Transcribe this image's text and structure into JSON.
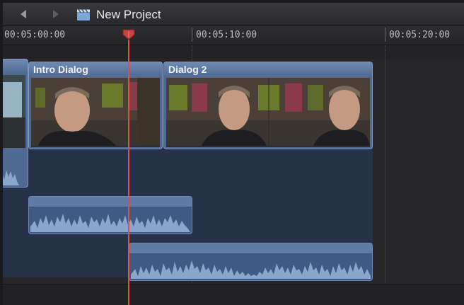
{
  "window": {
    "title": "New Project",
    "back_icon": "chevron-left-icon",
    "forward_icon": "chevron-right-icon",
    "project_icon": "clapperboard-icon"
  },
  "ruler": {
    "timecodes": [
      "00:05:00:00",
      "00:05:10:00",
      "00:05:20:00"
    ],
    "playhead_color": "#e05048"
  },
  "clips": [
    {
      "name": "Intro Dialog"
    },
    {
      "name": "Dialog 2"
    }
  ],
  "colors": {
    "clip_video": "#4e6a92",
    "clip_header": "#6f8bb3",
    "audio_clip": "#3f5b85",
    "storyline": "#253247",
    "background": "#2a2a2d"
  }
}
